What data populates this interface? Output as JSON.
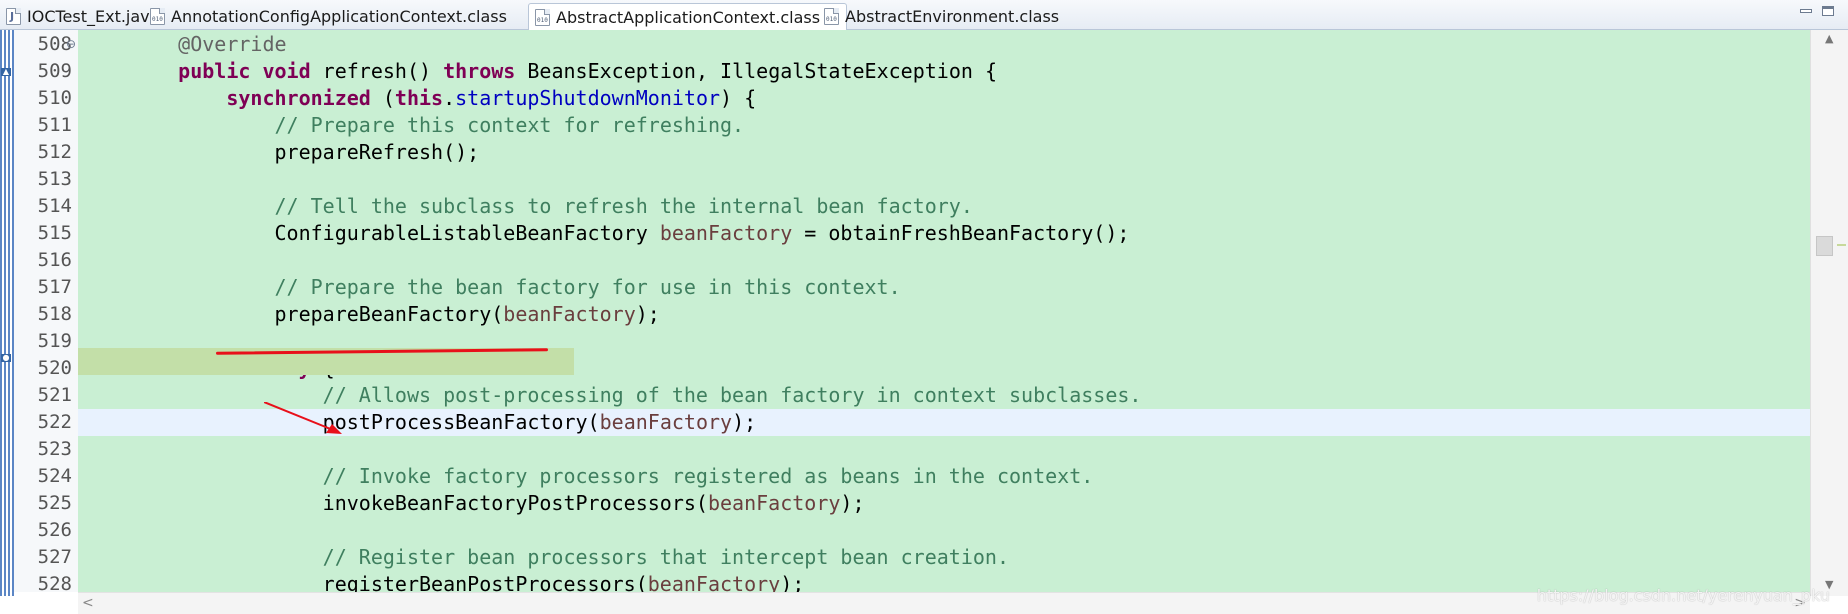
{
  "tabs": [
    {
      "label": "IOCTest_Ext.java",
      "icon": "java-file-icon",
      "active": false
    },
    {
      "label": "AnnotationConfigApplicationContext.class",
      "icon": "class-file-icon",
      "active": false
    },
    {
      "label": "AbstractApplicationContext.class",
      "icon": "class-file-icon",
      "active": true
    },
    {
      "label": "AbstractEnvironment.class",
      "icon": "class-file-icon",
      "active": false
    }
  ],
  "tab_close_glyph": "✕",
  "fold_glyph": "⊖",
  "editor": {
    "current_line": "522",
    "lines": [
      {
        "n": "508",
        "tokens": [
          {
            "t": "    "
          },
          {
            "t": "@Override",
            "c": "ann"
          }
        ]
      },
      {
        "n": "509",
        "tokens": [
          {
            "t": "    "
          },
          {
            "t": "public",
            "c": "kw"
          },
          {
            "t": " "
          },
          {
            "t": "void",
            "c": "kw"
          },
          {
            "t": " refresh() "
          },
          {
            "t": "throws",
            "c": "kw"
          },
          {
            "t": " BeansException, IllegalStateException {"
          }
        ]
      },
      {
        "n": "510",
        "tokens": [
          {
            "t": "        "
          },
          {
            "t": "synchronized",
            "c": "kw"
          },
          {
            "t": " ("
          },
          {
            "t": "this",
            "c": "kw"
          },
          {
            "t": "."
          },
          {
            "t": "startupShutdownMonitor",
            "c": "fld"
          },
          {
            "t": ") {"
          }
        ]
      },
      {
        "n": "511",
        "tokens": [
          {
            "t": "            "
          },
          {
            "t": "// Prepare this context for refreshing.",
            "c": "cm"
          }
        ]
      },
      {
        "n": "512",
        "tokens": [
          {
            "t": "            prepareRefresh();"
          }
        ]
      },
      {
        "n": "513",
        "tokens": []
      },
      {
        "n": "514",
        "tokens": [
          {
            "t": "            "
          },
          {
            "t": "// Tell the subclass to refresh the internal bean factory.",
            "c": "cm"
          }
        ]
      },
      {
        "n": "515",
        "tokens": [
          {
            "t": "            ConfigurableListableBeanFactory "
          },
          {
            "t": "beanFactory",
            "c": "var"
          },
          {
            "t": " = obtainFreshBeanFactory();"
          }
        ]
      },
      {
        "n": "516",
        "tokens": []
      },
      {
        "n": "517",
        "tokens": [
          {
            "t": "            "
          },
          {
            "t": "// Prepare the bean factory for use in this context.",
            "c": "cm"
          }
        ]
      },
      {
        "n": "518",
        "tokens": [
          {
            "t": "            prepareBeanFactory("
          },
          {
            "t": "beanFactory",
            "c": "var"
          },
          {
            "t": ");"
          }
        ]
      },
      {
        "n": "519",
        "tokens": []
      },
      {
        "n": "520",
        "tokens": [
          {
            "t": "            "
          },
          {
            "t": "try",
            "c": "kw"
          },
          {
            "t": " {"
          }
        ]
      },
      {
        "n": "521",
        "tokens": [
          {
            "t": "                "
          },
          {
            "t": "// Allows post-processing of the bean factory in context subclasses.",
            "c": "cm"
          }
        ]
      },
      {
        "n": "522",
        "tokens": [
          {
            "t": "                postProcessBeanFactory("
          },
          {
            "t": "beanFactory",
            "c": "var"
          },
          {
            "t": ");"
          }
        ]
      },
      {
        "n": "523",
        "tokens": []
      },
      {
        "n": "524",
        "tokens": [
          {
            "t": "                "
          },
          {
            "t": "// Invoke factory processors registered as beans in the context.",
            "c": "cm"
          }
        ]
      },
      {
        "n": "525",
        "tokens": [
          {
            "t": "                invokeBeanFactoryPostProcessors("
          },
          {
            "t": "beanFactory",
            "c": "var"
          },
          {
            "t": ");"
          }
        ]
      },
      {
        "n": "526",
        "tokens": []
      },
      {
        "n": "527",
        "tokens": [
          {
            "t": "                "
          },
          {
            "t": "// Register bean processors that intercept bean creation.",
            "c": "cm"
          }
        ]
      },
      {
        "n": "528",
        "tokens": [
          {
            "t": "                registerBeanPostProcessors("
          },
          {
            "t": "beanFactory",
            "c": "var"
          },
          {
            "t": ");"
          }
        ]
      }
    ]
  },
  "scroll_left_glyph": "<",
  "scroll_right_glyph": ">",
  "scroll_up_glyph": "▲",
  "scroll_down_glyph": "▼",
  "watermark": "https://blog.csdn.net/yerenyuan_pku",
  "colors": {
    "code_bg": "#c9efd3",
    "current_line_bg": "#e8f2fe",
    "keyword": "#7f0055",
    "comment": "#3f7f5f",
    "field": "#0000c0",
    "local_var": "#6a3e3e",
    "annotation": "#646464",
    "annotation_red": "#e8101a"
  }
}
